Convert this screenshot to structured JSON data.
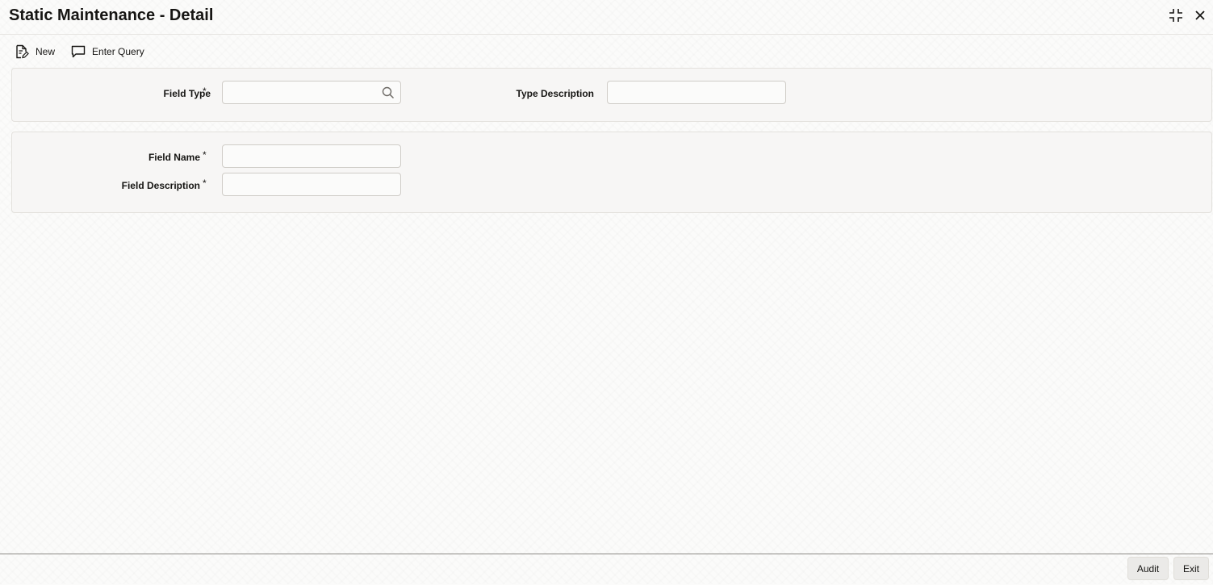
{
  "window": {
    "title": "Static Maintenance - Detail"
  },
  "toolbar": {
    "new_label": "New",
    "enter_query_label": "Enter Query"
  },
  "header_panel": {
    "field_type": {
      "label": "Field Type",
      "required_mark": "*",
      "value": ""
    },
    "type_description": {
      "label": "Type Description",
      "value": ""
    }
  },
  "detail_panel": {
    "field_name": {
      "label": "Field Name",
      "required_mark": "*",
      "value": ""
    },
    "field_description": {
      "label": "Field Description",
      "required_mark": "*",
      "value": ""
    }
  },
  "footer": {
    "audit_label": "Audit",
    "exit_label": "Exit"
  },
  "colors": {
    "background": "#fbfbfa",
    "panel": "#f7f6f5",
    "text": "#161513",
    "border": "#cfccc7"
  }
}
